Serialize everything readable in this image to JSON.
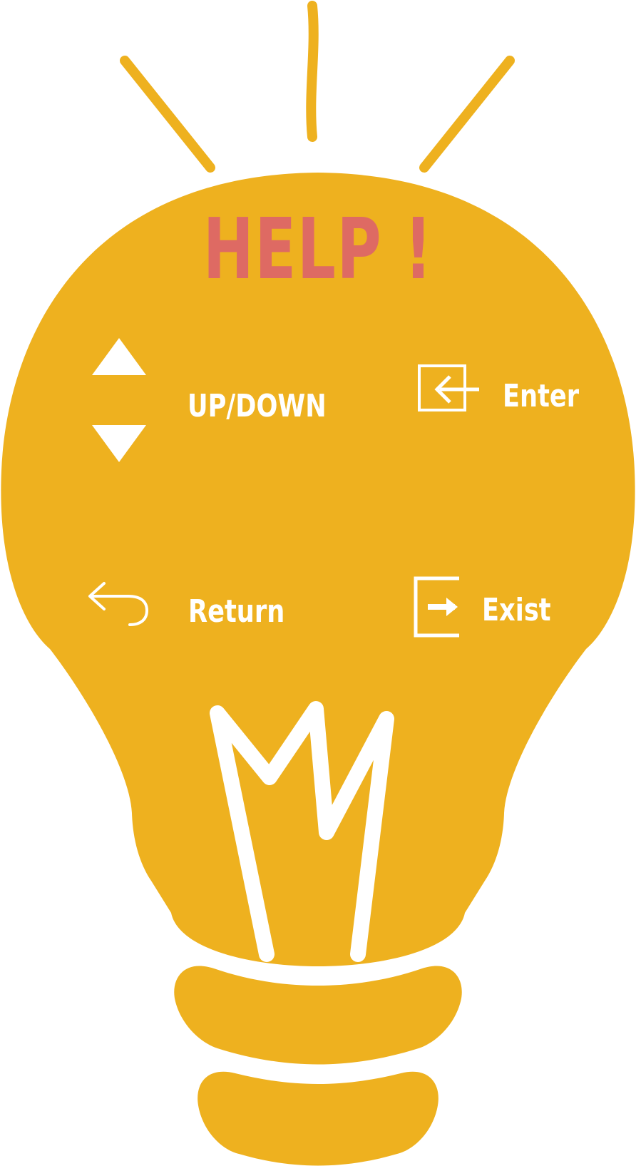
{
  "title": "HELP !",
  "items": {
    "updown": {
      "label": "UP/DOWN",
      "icon_up": "triangle-up-icon",
      "icon_down": "triangle-down-icon"
    },
    "enter": {
      "label": "Enter",
      "icon": "enter-icon"
    },
    "return": {
      "label": "Return",
      "icon": "return-icon"
    },
    "exist": {
      "label": "Exist",
      "icon": "exit-icon"
    }
  },
  "colors": {
    "bulb": "#EEB11F",
    "title": "#DE6A63",
    "icons_and_labels": "#FFFFFF",
    "background": "#FFFFFF"
  }
}
